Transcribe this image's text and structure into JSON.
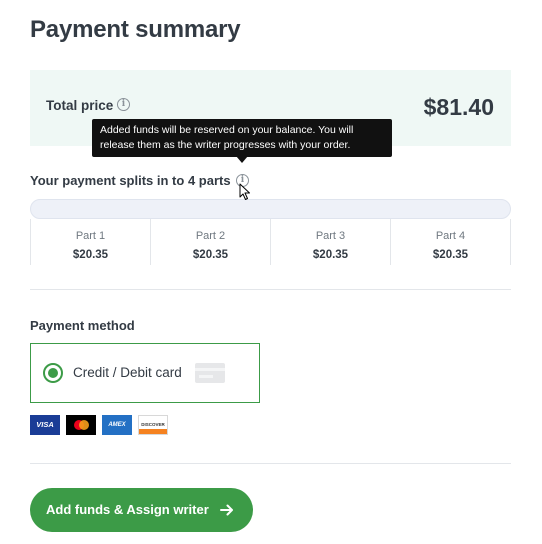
{
  "page_title": "Payment summary",
  "total": {
    "label": "Total price",
    "price": "$81.40",
    "info_icon": "info-icon"
  },
  "tooltip": {
    "text": "Added funds will be reserved on your balance. You will release them as the writer progresses with your order."
  },
  "splits": {
    "label": "Your payment splits in to 4 parts",
    "info_icon": "info-icon",
    "progress_fraction": 0,
    "parts": [
      {
        "label": "Part 1",
        "amount": "$20.35"
      },
      {
        "label": "Part 2",
        "amount": "$20.35"
      },
      {
        "label": "Part 3",
        "amount": "$20.35"
      },
      {
        "label": "Part 4",
        "amount": "$20.35"
      }
    ]
  },
  "payment_method": {
    "label": "Payment method",
    "option_label": "Credit / Debit card",
    "selected": true,
    "card_logos": [
      {
        "name": "visa-logo",
        "text": "VISA"
      },
      {
        "name": "mastercard-logo",
        "text": ""
      },
      {
        "name": "amex-logo",
        "text": "AMEX"
      },
      {
        "name": "discover-logo",
        "text": "DISCOVER"
      }
    ]
  },
  "cta": {
    "label": "Add funds & Assign writer",
    "icon": "arrow-right-icon"
  },
  "colors": {
    "accent": "#3c9b47",
    "total_bg": "#eff8f5",
    "tooltip_bg": "#111111"
  }
}
